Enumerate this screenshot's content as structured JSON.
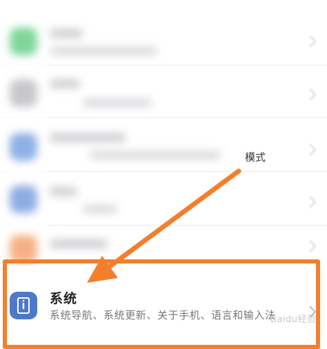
{
  "overlay_label": "模式",
  "system_item": {
    "title": "系统",
    "subtitle": "系统导航、系统更新、关于手机、语言和输入法"
  },
  "watermark": "Baidu经验",
  "colors": {
    "highlight": "#f37f2c",
    "system_icon": "#4d79c9"
  }
}
